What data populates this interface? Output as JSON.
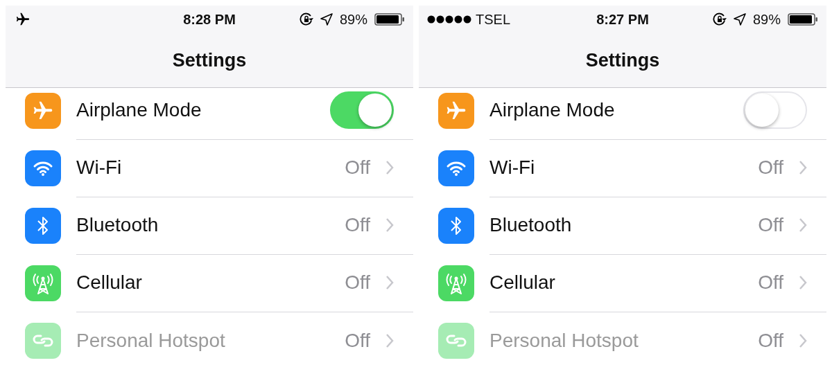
{
  "screens": [
    {
      "status_bar": {
        "airplane": true,
        "time": "8:28 PM",
        "battery": "89%"
      },
      "title": "Settings",
      "rows": [
        {
          "kind": "toggle",
          "color": "#f7961c",
          "label": "Airplane Mode",
          "on": true,
          "disabled": false
        },
        {
          "kind": "link",
          "color": "#1a82fb",
          "label": "Wi-Fi",
          "value": "Off",
          "disabled": false
        },
        {
          "kind": "link",
          "color": "#1a82fb",
          "label": "Bluetooth",
          "value": "Off",
          "disabled": false
        },
        {
          "kind": "link",
          "color": "#4cd964",
          "label": "Cellular",
          "value": "Off",
          "disabled": false
        },
        {
          "kind": "link",
          "color": "#a6ecb4",
          "label": "Personal Hotspot",
          "value": "Off",
          "disabled": true
        }
      ]
    },
    {
      "status_bar": {
        "airplane": false,
        "carrier": "TSEL",
        "time": "8:27 PM",
        "battery": "89%"
      },
      "title": "Settings",
      "rows": [
        {
          "kind": "toggle",
          "color": "#f7961c",
          "label": "Airplane Mode",
          "on": false,
          "disabled": false
        },
        {
          "kind": "link",
          "color": "#1a82fb",
          "label": "Wi-Fi",
          "value": "Off",
          "disabled": false
        },
        {
          "kind": "link",
          "color": "#1a82fb",
          "label": "Bluetooth",
          "value": "Off",
          "disabled": false
        },
        {
          "kind": "link",
          "color": "#4cd964",
          "label": "Cellular",
          "value": "Off",
          "disabled": false
        },
        {
          "kind": "link",
          "color": "#a6ecb4",
          "label": "Personal Hotspot",
          "value": "Off",
          "disabled": true
        }
      ]
    }
  ]
}
